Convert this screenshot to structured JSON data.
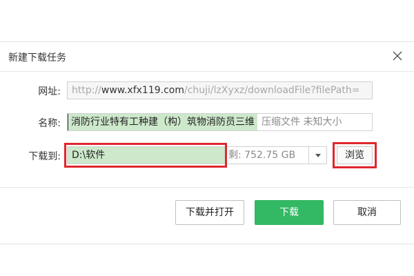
{
  "dialog": {
    "title": "新建下载任务"
  },
  "form": {
    "url_label": "网址:",
    "url_prefix": "http://",
    "url_domain": "www.xfx119.com",
    "url_rest": "/chuji/lzXyxz/downloadFile?filePath=",
    "name_label": "名称:",
    "name_value": "消防行业特有工种建（构）筑物消防员三维",
    "name_info": "压缩文件 未知大小",
    "save_label": "下载到:",
    "save_path": "D:\\软件",
    "free_space": "剩: 752.75 GB",
    "browse_label": "浏览"
  },
  "buttons": {
    "download_open": "下载并打开",
    "download": "下载",
    "cancel": "取消"
  },
  "icons": {
    "close": "close-icon",
    "dropdown": "chevron-down-icon"
  },
  "colors": {
    "accent_green": "#33b864",
    "selection_green": "#cde8cb",
    "highlight_red": "#e0262d"
  }
}
